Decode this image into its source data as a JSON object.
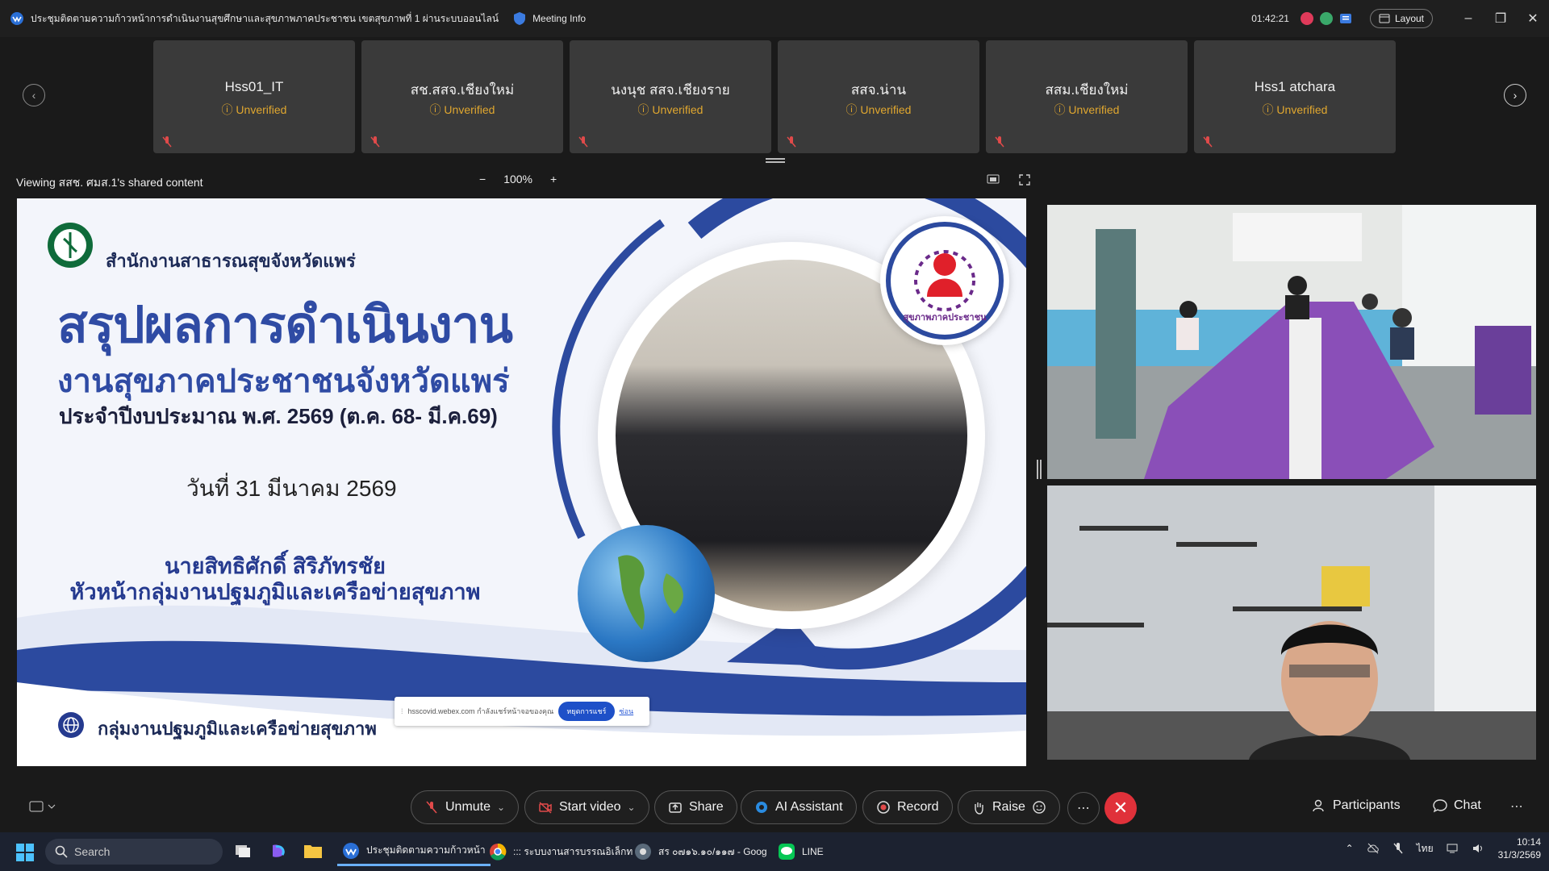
{
  "titlebar": {
    "title": "ประชุมติดตามความก้าวหน้าการดำเนินงานสุขศึกษาและสุขภาพภาคประชาชน เขตสุขภาพที่ 1 ผ่านระบบออนไลน์",
    "meeting_info": "Meeting Info",
    "timer": "01:42:21",
    "layout_label": "Layout"
  },
  "participants_strip": [
    {
      "name": "Hss01_IT",
      "status": "Unverified"
    },
    {
      "name": "สช.สสจ.เชียงใหม่",
      "status": "Unverified"
    },
    {
      "name": "นงนุช สสจ.เชียงราย",
      "status": "Unverified"
    },
    {
      "name": "สสจ.น่าน",
      "status": "Unverified"
    },
    {
      "name": "สสม.เชียงใหม่",
      "status": "Unverified"
    },
    {
      "name": "Hss1 atchara",
      "status": "Unverified"
    }
  ],
  "share_bar": {
    "viewing_text": "Viewing สสช. ศมส.1's shared content",
    "zoom_level": "100%"
  },
  "slide": {
    "office": "สำนักงานสาธารณสุขจังหวัดแพร่",
    "heading1": "สรุปผลการดำเนินงาน",
    "heading2": "งานสุขภาคประชาชนจังหวัดแพร่",
    "heading3": "ประจำปีงบประมาณ พ.ศ. 2569 (ต.ค. 68- มี.ค.69)",
    "date": "วันที่ 31 มีนาคม 2569",
    "presenter_name": "นายสิทธิศักดิ์ สิริภัทรชัย",
    "presenter_title": "หัวหน้ากลุ่มงานปฐมภูมิและเครือข่ายสุขภาพ",
    "footer": "กลุ่มงานปฐมภูมิและเครือข่ายสุขภาพ",
    "logo_text": "สุขภาพภาคประชาชน",
    "share_popup": {
      "text": "hsscovid.webex.com กำลังแชร์หน้าจอของคุณ",
      "stop": "หยุดการแชร์",
      "hide": "ซ่อน"
    }
  },
  "controls": {
    "unmute": "Unmute",
    "start_video": "Start video",
    "share": "Share",
    "ai_assistant": "AI Assistant",
    "record": "Record",
    "raise": "Raise",
    "participants": "Participants",
    "chat": "Chat"
  },
  "taskbar": {
    "search": "Search",
    "apps": [
      {
        "label": "ประชุมติดตามความก้าวหน้า"
      },
      {
        "label": "::: ระบบงานสารบรรณอิเล็กท"
      },
      {
        "label": "สร ๐๗๑๖.๑๐/๑๑๗ - Goog"
      },
      {
        "label": "LINE"
      }
    ],
    "lang": "ไทย",
    "time": "10:14",
    "date": "31/3/2569"
  },
  "colors": {
    "accent_blue": "#2f4ba4",
    "unverified": "#e0a72f",
    "end_red": "#e0313a"
  }
}
